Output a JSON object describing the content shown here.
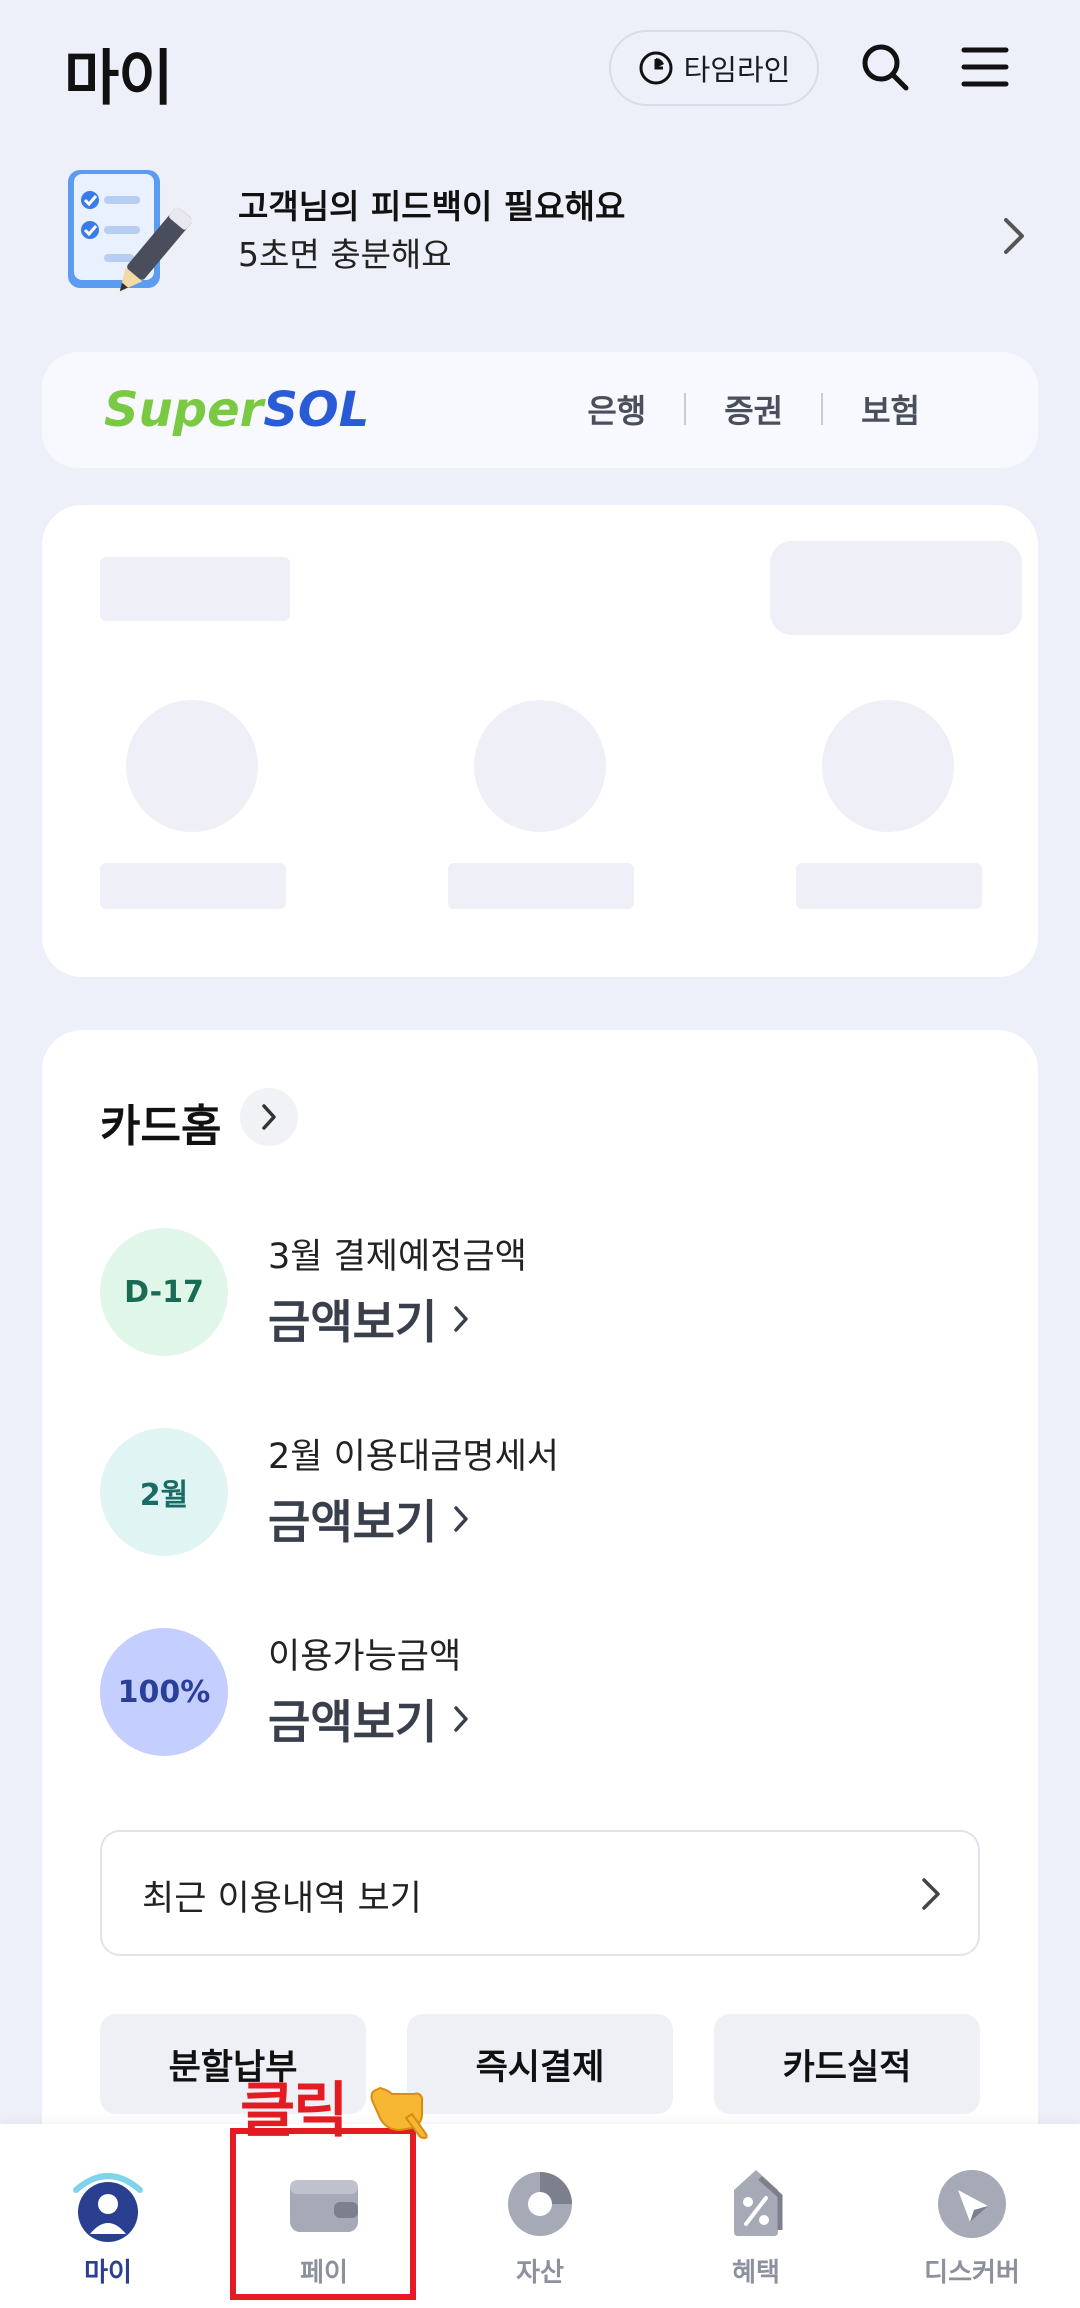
{
  "header": {
    "title": "마이",
    "timeline_label": "타임라인"
  },
  "feedback": {
    "title": "고객님의 피드백이 필요해요",
    "subtitle": "5초면 충분해요"
  },
  "supersol": {
    "logo_super": "Super",
    "logo_sol": "SOL",
    "links": [
      "은행",
      "증권",
      "보험"
    ]
  },
  "cardhome": {
    "title": "카드홈",
    "items": [
      {
        "badge": "D-17",
        "label": "3월 결제예정금액",
        "amount": "금액보기",
        "badge_bg": "#dff6e8",
        "badge_color": "#1a6b54"
      },
      {
        "badge": "2월",
        "label": "2월 이용대금명세서",
        "amount": "금액보기",
        "badge_bg": "#e0f5f3",
        "badge_color": "#1a6b66"
      },
      {
        "badge": "100%",
        "label": "이용가능금액",
        "amount": "금액보기",
        "badge_bg": "#c4ceff",
        "badge_color": "#2a3f9a"
      }
    ],
    "recent_label": "최근 이용내역 보기",
    "quick_buttons": [
      "분할납부",
      "즉시결제",
      "카드실적"
    ]
  },
  "annotation": {
    "click_label": "클릭"
  },
  "bottom_nav": {
    "items": [
      {
        "label": "마이",
        "icon": "my-icon",
        "active": true
      },
      {
        "label": "페이",
        "icon": "wallet-icon",
        "active": false
      },
      {
        "label": "자산",
        "icon": "pie-chart-icon",
        "active": false
      },
      {
        "label": "혜택",
        "icon": "discount-tag-icon",
        "active": false
      },
      {
        "label": "디스커버",
        "icon": "compass-icon",
        "active": false
      }
    ]
  }
}
